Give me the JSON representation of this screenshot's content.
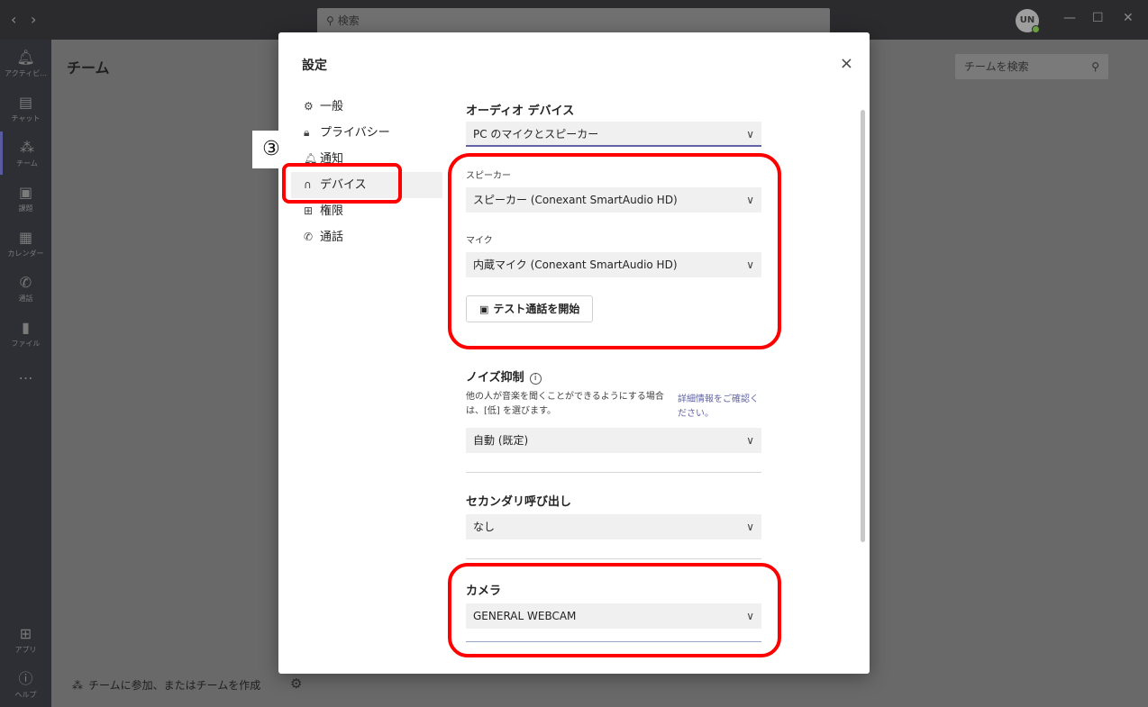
{
  "titlebar": {
    "back": "‹",
    "forward": "›",
    "search_placeholder": "検索",
    "avatar_initials": "UN",
    "colors": {
      "bg": "#2b2b2e"
    }
  },
  "rail": {
    "items": [
      {
        "label": "アクティビ...",
        "icon": "bell-icon"
      },
      {
        "label": "チャット",
        "icon": "chat-icon"
      },
      {
        "label": "チーム",
        "icon": "teams-icon"
      },
      {
        "label": "課題",
        "icon": "assignments-icon"
      },
      {
        "label": "カレンダー",
        "icon": "calendar-icon"
      },
      {
        "label": "通話",
        "icon": "phone-icon"
      },
      {
        "label": "ファイル",
        "icon": "file-icon"
      },
      {
        "label": "…",
        "icon": "more-icon"
      },
      {
        "label": "アプリ",
        "icon": "apps-icon"
      },
      {
        "label": "ヘルプ",
        "icon": "help-icon"
      }
    ]
  },
  "main": {
    "title": "チーム",
    "team_search_placeholder": "チームを検索",
    "join_team": "チームに参加、またはチームを作成"
  },
  "dialog": {
    "title": "設定",
    "close": "×",
    "menu": [
      {
        "label": "一般",
        "icon": "gear-icon"
      },
      {
        "label": "プライバシー",
        "icon": "lock-icon"
      },
      {
        "label": "通知",
        "icon": "bell-icon"
      },
      {
        "label": "デバイス",
        "icon": "headset-icon",
        "active": true
      },
      {
        "label": "権限",
        "icon": "grid-icon"
      },
      {
        "label": "通話",
        "icon": "phone-icon"
      }
    ],
    "audio": {
      "title": "オーディオ デバイス",
      "value": "PC のマイクとスピーカー"
    },
    "speaker": {
      "label": "スピーカー",
      "value": "スピーカー (Conexant SmartAudio HD)"
    },
    "mic": {
      "label": "マイク",
      "value": "内蔵マイク (Conexant SmartAudio HD)"
    },
    "test_call": "テスト通話を開始",
    "noise": {
      "title": "ノイズ抑制",
      "info": "i",
      "desc": "他の人が音楽を聞くことができるようにする場合は、[低] を選びます。",
      "link": "詳細情報をご確認ください。",
      "value": "自動 (既定)"
    },
    "secondary_ring": {
      "title": "セカンダリ呼び出し",
      "value": "なし"
    },
    "camera": {
      "title": "カメラ",
      "value": "GENERAL WEBCAM"
    }
  },
  "annotation": {
    "number": "③",
    "color": "#ff0000"
  },
  "colors": {
    "accent": "#6264a7",
    "highlight": "#ff0000"
  }
}
